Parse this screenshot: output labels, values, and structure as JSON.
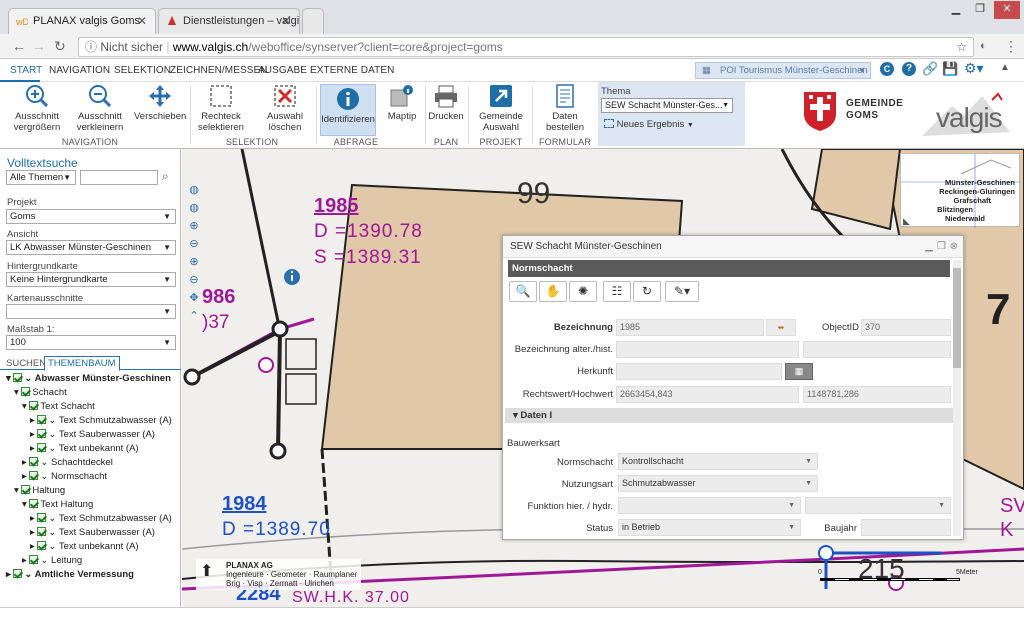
{
  "browser": {
    "tabs": [
      {
        "title": "PLANAX valgis Goms"
      },
      {
        "title": "Dienstleistungen – valgis"
      }
    ],
    "url_security": "Nicht sicher",
    "url_host": "www.valgis.ch",
    "url_path": "/weboffice/synserver?client=core&project=goms"
  },
  "ribbon": {
    "menu_tabs": [
      "START",
      "NAVIGATION",
      "SELEKTION",
      "ZEICHNEN/MESSEN",
      "AUSGABE",
      "EXTERNE DATEN"
    ],
    "poi_select": "POI Tourismus Münster-Geschinen",
    "buttons": {
      "zoom_in": "Ausschnitt vergrößern",
      "zoom_out": "Ausschnitt verkleinern",
      "pan": "Verschieben",
      "rect_select": "Rechteck selektieren",
      "clear_select": "Auswahl löschen",
      "identify": "Identifizieren",
      "maptip": "Maptip",
      "print": "Drucken",
      "municipality": "Gemeinde Auswahl",
      "order": "Daten bestellen"
    },
    "groups": {
      "navigation": "NAVIGATION",
      "selection": "SELEKTION",
      "query": "ABFRAGE",
      "plan": "PLAN",
      "project": "PROJEKT",
      "form": "FORMULAR"
    },
    "thema_label": "Thema",
    "thema_value": "SEW Schacht  Münster-Ges...",
    "new_result": "Neues Ergebnis",
    "logo_gemeinde_1": "GEMEINDE",
    "logo_gemeinde_2": "GOMS",
    "logo_valgis": "valgis"
  },
  "left": {
    "search_title": "Volltextsuche",
    "search_scope": "Alle Themen",
    "projekt_label": "Projekt",
    "projekt_value": "Goms",
    "ansicht_label": "Ansicht",
    "ansicht_value": "LK Abwasser Münster-Geschinen",
    "hintergrund_label": "Hintergrundkarte",
    "hintergrund_value": "Keine Hintergrundkarte",
    "karten_label": "Kartenausschnitte",
    "massstab_label": "Maßstab 1:",
    "massstab_value": "100",
    "tabs": [
      "SUCHEN",
      "THEMENBAUM"
    ],
    "tree": [
      "Abwasser Münster-Geschinen",
      "Schacht",
      "Text Schacht",
      "Text Schmutzabwasser (A)",
      "Text Sauberwasser (A)",
      "Text unbekannt (A)",
      "Schachtdeckel",
      "Normschacht",
      "Haltung",
      "Text Haltung",
      "Text Schmutzabwasser (A)",
      "Text Sauberwasser (A)",
      "Text unbekannt (A)",
      "Leitung",
      "Amtliche Vermessung"
    ]
  },
  "map": {
    "labels": {
      "n99": "99",
      "n1985": "1985",
      "d1985": "D =1390.78",
      "s1985": "S =1389.31",
      "n986": "986",
      "n037": ")37",
      "n1984": "1984",
      "d1984": "D =1389.70",
      "n2284": "2284",
      "n215": "215",
      "n7": "7",
      "bottom": "SW.H.K. 37.00",
      "sv": "SV",
      "k": "K"
    },
    "overview_places": [
      "Münster-Geschinen",
      "Reckingen-Gluringen",
      "Grafschaft",
      "Blitzingen",
      "Niederwald"
    ],
    "planax_line1": "PLANAX AG",
    "planax_line2": "Ingenieure · Geometer · Raumplaner",
    "planax_line3": "Brig · Visp · Zermatt · Ulrichen",
    "scale_zero": "0",
    "scale_end": "5Meter"
  },
  "dialog": {
    "title": "SEW Schacht Münster-Geschinen",
    "header": "Normschacht",
    "fields": {
      "bezeichnung_label": "Bezeichnung",
      "bezeichnung_value": "1985",
      "objectid_label": "ObjectID",
      "objectid_value": "370",
      "alt_label": "Bezeichnung alter./hist.",
      "herkunft_label": "Herkunft",
      "coord_label": "Rechtswert/Hochwert",
      "rechtswert": "2663454,843",
      "hochwert": "1148781,286",
      "section": "Daten I",
      "bauwerksart": "Bauwerksart",
      "normschacht_label": "Normschacht",
      "normschacht_value": "Kontrollschacht",
      "nutzungsart_label": "Nutzungsart",
      "nutzungsart_value": "Schmutzabwasser",
      "funktion_label": "Funktion hier. / hydr.",
      "status_label": "Status",
      "status_value": "in Betrieb",
      "baujahr_label": "Baujahr"
    }
  }
}
